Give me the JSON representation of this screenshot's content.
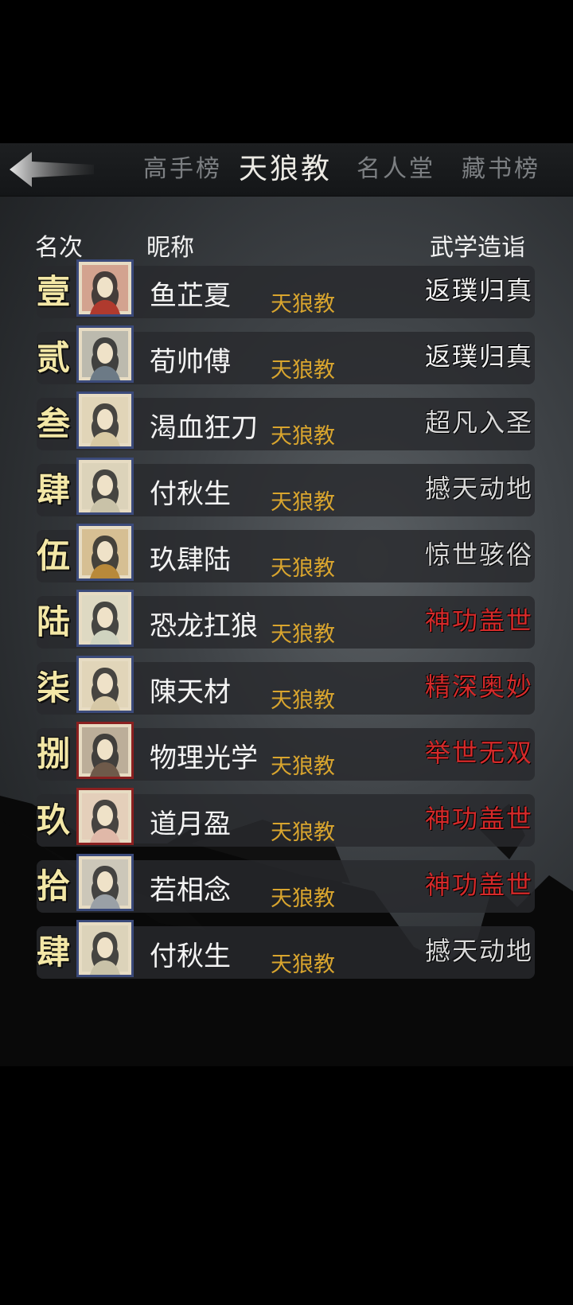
{
  "tabs": [
    {
      "label": "高手榜",
      "active": false
    },
    {
      "label": "天狼教",
      "active": true
    },
    {
      "label": "名人堂",
      "active": false
    },
    {
      "label": "藏书榜",
      "active": false
    }
  ],
  "header": {
    "rank": "名次",
    "nickname": "昵称",
    "martial": "武学造诣"
  },
  "colors": {
    "normal_level": "#f0f0f0",
    "red_level": "#d42a2a",
    "sect": "#d9a52e",
    "rank": "#f3e7a6"
  },
  "rows": [
    {
      "rank": "壹",
      "name": "鱼芷夏",
      "sect": "天狼教",
      "level": "返璞归真",
      "level_color": "#f0f0f0",
      "avatar_bg": "#b03a2e"
    },
    {
      "rank": "贰",
      "name": "荀帅傅",
      "sect": "天狼教",
      "level": "返璞归真",
      "level_color": "#f0f0f0",
      "avatar_bg": "#6c7a86"
    },
    {
      "rank": "叁",
      "name": "渴血狂刀",
      "sect": "天狼教",
      "level": "超凡入圣",
      "level_color": "#d8d8d8",
      "avatar_bg": "#d8c9a3"
    },
    {
      "rank": "肆",
      "name": "付秋生",
      "sect": "天狼教",
      "level": "撼天动地",
      "level_color": "#d8d8d8",
      "avatar_bg": "#c9c2a8"
    },
    {
      "rank": "伍",
      "name": "玖肆陆",
      "sect": "天狼教",
      "level": "惊世骇俗",
      "level_color": "#d8d8d8",
      "avatar_bg": "#b8893a"
    },
    {
      "rank": "陆",
      "name": "恐龙扛狼",
      "sect": "天狼教",
      "level": "神功盖世",
      "level_color": "#d42a2a",
      "avatar_bg": "#cfd3bf"
    },
    {
      "rank": "柒",
      "name": "陳天材",
      "sect": "天狼教",
      "level": "精深奥妙",
      "level_color": "#d42a2a",
      "avatar_bg": "#d6c8a6"
    },
    {
      "rank": "捌",
      "name": "物理光学",
      "sect": "天狼教",
      "level": "举世无双",
      "level_color": "#d42a2a",
      "avatar_bg": "#6e5a4a"
    },
    {
      "rank": "玖",
      "name": "道月盈",
      "sect": "天狼教",
      "level": "神功盖世",
      "level_color": "#d42a2a",
      "avatar_bg": "#e0b8a8"
    },
    {
      "rank": "拾",
      "name": "若相念",
      "sect": "天狼教",
      "level": "神功盖世",
      "level_color": "#d42a2a",
      "avatar_bg": "#9aa0a6"
    },
    {
      "rank": "肆",
      "name": "付秋生",
      "sect": "天狼教",
      "level": "撼天动地",
      "level_color": "#d8d8d8",
      "avatar_bg": "#c9c2a8"
    }
  ]
}
